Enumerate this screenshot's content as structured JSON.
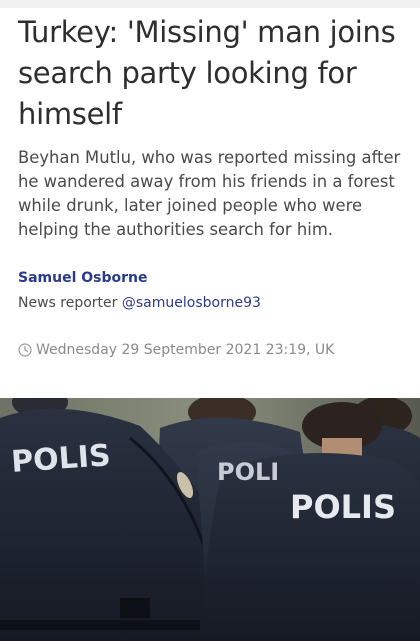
{
  "article": {
    "headline": "Turkey: 'Missing' man joins search party looking for himself",
    "standfirst": "Beyhan Mutlu, who was reported missing after he wandered away from his friends in a forest while drunk, later joined people who were helping the authorities search for him.",
    "author_name": "Samuel Osborne",
    "author_role": "News reporter",
    "author_handle": "@samuelosborne93",
    "timestamp": "Wednesday 29 September 2021 23:19, UK",
    "timestamp_icon": "clock-icon"
  },
  "photo": {
    "jacket_text_left": "POLIS",
    "jacket_text_middle": "POLI",
    "jacket_text_right": "POLIS"
  }
}
